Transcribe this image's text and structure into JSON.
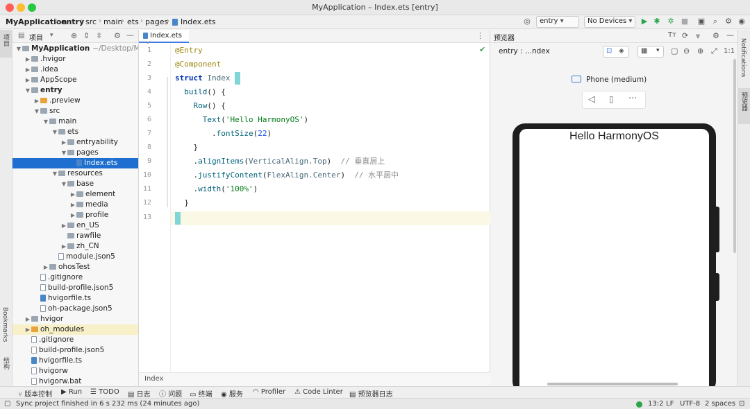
{
  "window": {
    "title": "MyApplication – Index.ets [entry]"
  },
  "breadcrumbs": [
    "MyApplication",
    "entry",
    "src",
    "main",
    "ets",
    "pages",
    "Index.ets"
  ],
  "toolbar": {
    "module_select": "entry",
    "device_select": "No Devices"
  },
  "left_strip": {
    "project_label": "项目",
    "bookmarks_label": "Bookmarks",
    "structure_label": "结构"
  },
  "project_panel": {
    "title": "项目"
  },
  "tree": [
    {
      "label": "MyApplication",
      "suffix": "~/Desktop/MyA",
      "bold": true,
      "arrow": "open"
    },
    {
      "label": ".hvigor",
      "arrow": "closed"
    },
    {
      "label": ".idea",
      "arrow": "closed"
    },
    {
      "label": "AppScope",
      "arrow": "closed"
    },
    {
      "label": "entry",
      "bold": true,
      "arrow": "open"
    },
    {
      "label": ".preview",
      "arrow": "closed"
    },
    {
      "label": "src",
      "arrow": "open"
    },
    {
      "label": "main",
      "arrow": "open"
    },
    {
      "label": "ets",
      "arrow": "open"
    },
    {
      "label": "entryability",
      "arrow": "closed"
    },
    {
      "label": "pages",
      "arrow": "open"
    },
    {
      "label": "Index.ets",
      "arrow": ""
    },
    {
      "label": "resources",
      "arrow": "open"
    },
    {
      "label": "base",
      "arrow": "open"
    },
    {
      "label": "element",
      "arrow": "closed"
    },
    {
      "label": "media",
      "arrow": "closed"
    },
    {
      "label": "profile",
      "arrow": "closed"
    },
    {
      "label": "en_US",
      "arrow": "closed"
    },
    {
      "label": "rawfile",
      "arrow": ""
    },
    {
      "label": "zh_CN",
      "arrow": "closed"
    },
    {
      "label": "module.json5",
      "arrow": ""
    },
    {
      "label": "ohosTest",
      "arrow": "closed"
    },
    {
      "label": ".gitignore",
      "arrow": ""
    },
    {
      "label": "build-profile.json5",
      "arrow": ""
    },
    {
      "label": "hvigorfile.ts",
      "arrow": ""
    },
    {
      "label": "oh-package.json5",
      "arrow": ""
    },
    {
      "label": "hvigor",
      "arrow": "closed"
    },
    {
      "label": "oh_modules",
      "arrow": "closed"
    },
    {
      "label": ".gitignore",
      "arrow": ""
    },
    {
      "label": "build-profile.json5",
      "arrow": ""
    },
    {
      "label": "hvigorfile.ts",
      "arrow": ""
    },
    {
      "label": "hvigorw",
      "arrow": ""
    },
    {
      "label": "hvigorw.bat",
      "arrow": ""
    }
  ],
  "editor": {
    "tab_label": "Index.ets",
    "footer_label": "Index",
    "line_numbers": [
      "1",
      "2",
      "3",
      "4",
      "5",
      "6",
      "7",
      "8",
      "9",
      "10",
      "11",
      "12",
      "13"
    ]
  },
  "preview": {
    "panel_title": "预览器",
    "path_label": "entry : ...ndex",
    "device_label": "Phone (medium)",
    "screen_text": "Hello HarmonyOS",
    "zoom_label": "1:1"
  },
  "right_strip": {
    "notifications_label": "Notifications",
    "previewer_label": "预览器"
  },
  "bottom_tools": [
    "版本控制",
    "Run",
    "TODO",
    "日志",
    "问题",
    "终端",
    "服务",
    "Profiler",
    "Code Linter",
    "预览器日志"
  ],
  "status": {
    "message": "Sync project finished in 6 s 232 ms (24 minutes ago)",
    "position": "13:2",
    "line_ending": "LF",
    "encoding": "UTF-8",
    "indent": "2 spaces"
  }
}
